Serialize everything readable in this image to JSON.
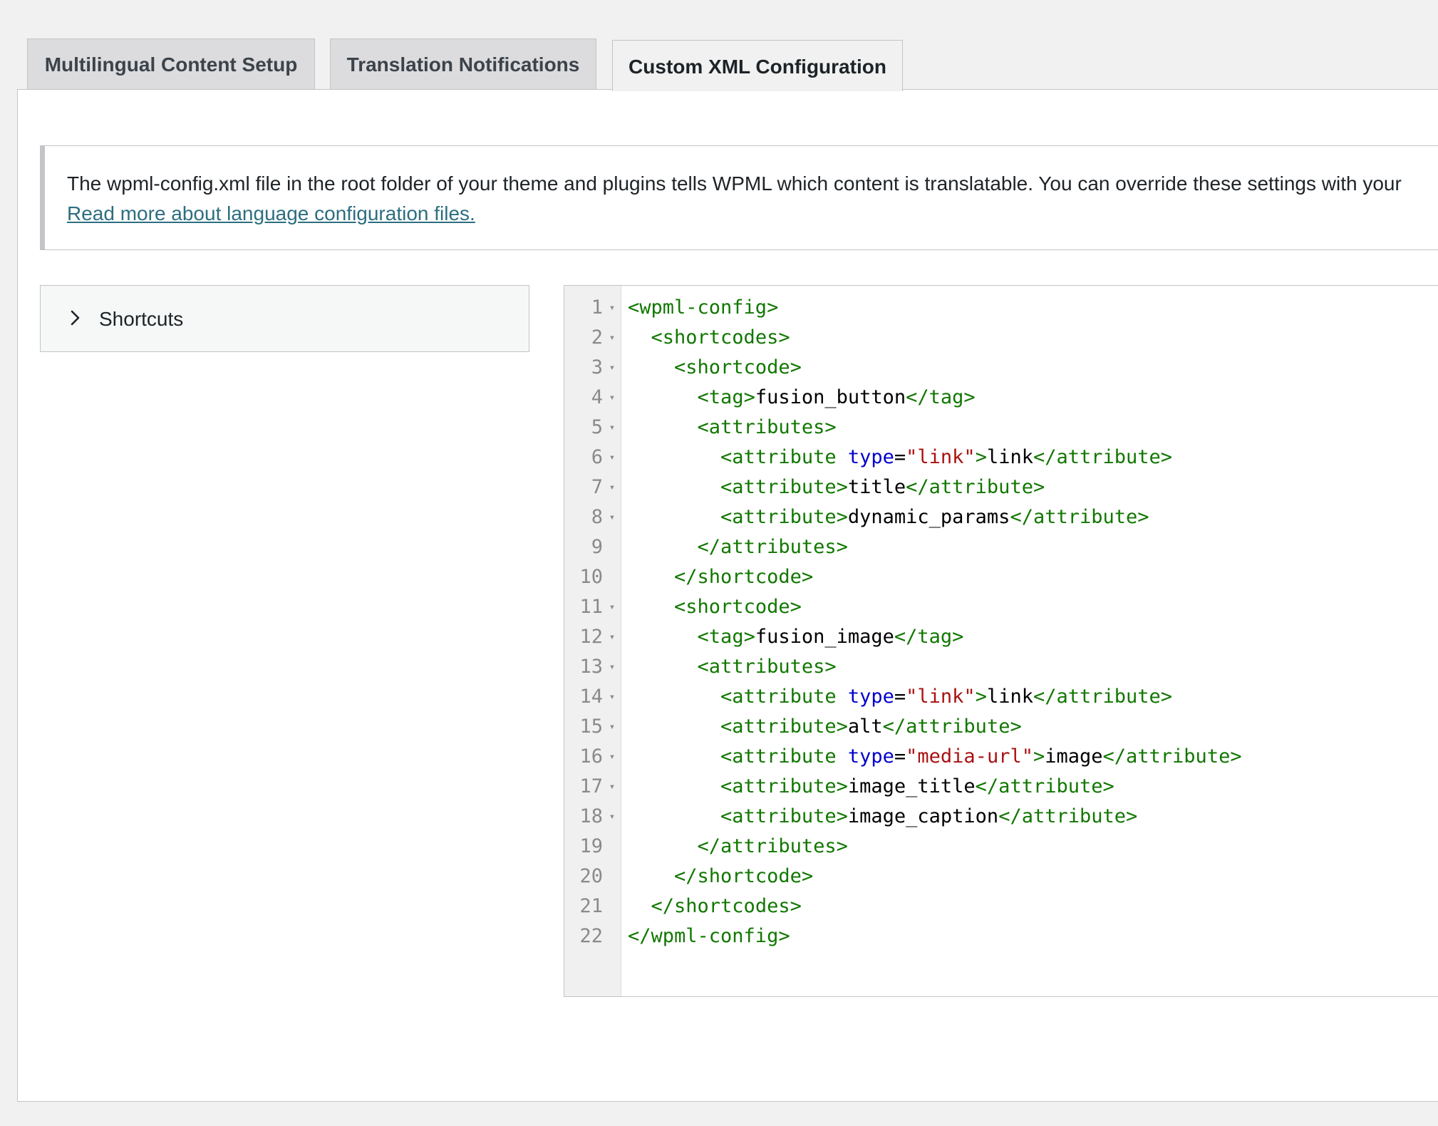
{
  "tabs": [
    {
      "label": "Multilingual Content Setup",
      "active": false
    },
    {
      "label": "Translation Notifications",
      "active": false
    },
    {
      "label": "Custom XML Configuration",
      "active": true
    }
  ],
  "notice": {
    "text": "The wpml-config.xml file in the root folder of your theme and plugins tells WPML which content is translatable. You can override these settings with your",
    "link_text": "Read more about language configuration files."
  },
  "shortcuts": {
    "label": "Shortcuts",
    "icon": "chevron-right-icon"
  },
  "editor": {
    "syntax_colors": {
      "tag": "#117700",
      "attribute": "#0000cc",
      "string": "#aa1111",
      "text": "#000000"
    },
    "lines": [
      {
        "n": "1",
        "fold": "▾",
        "tokens": [
          [
            "tg",
            "<wpml-config>"
          ]
        ]
      },
      {
        "n": "2",
        "fold": "▾",
        "tokens": [
          [
            "tx",
            "  "
          ],
          [
            "tg",
            "<shortcodes>"
          ]
        ]
      },
      {
        "n": "3",
        "fold": "▾",
        "tokens": [
          [
            "tx",
            "    "
          ],
          [
            "tg",
            "<shortcode>"
          ]
        ]
      },
      {
        "n": "4",
        "fold": "▾",
        "tokens": [
          [
            "tx",
            "      "
          ],
          [
            "tg",
            "<tag>"
          ],
          [
            "tx",
            "fusion_button"
          ],
          [
            "tg",
            "</tag>"
          ]
        ]
      },
      {
        "n": "5",
        "fold": "▾",
        "tokens": [
          [
            "tx",
            "      "
          ],
          [
            "tg",
            "<attributes>"
          ]
        ]
      },
      {
        "n": "6",
        "fold": "▾",
        "tokens": [
          [
            "tx",
            "        "
          ],
          [
            "tg",
            "<attribute "
          ],
          [
            "at",
            "type"
          ],
          [
            "tx",
            "="
          ],
          [
            "st",
            "\"link\""
          ],
          [
            "tg",
            ">"
          ],
          [
            "tx",
            "link"
          ],
          [
            "tg",
            "</attribute>"
          ]
        ]
      },
      {
        "n": "7",
        "fold": "▾",
        "tokens": [
          [
            "tx",
            "        "
          ],
          [
            "tg",
            "<attribute>"
          ],
          [
            "tx",
            "title"
          ],
          [
            "tg",
            "</attribute>"
          ]
        ]
      },
      {
        "n": "8",
        "fold": "▾",
        "tokens": [
          [
            "tx",
            "        "
          ],
          [
            "tg",
            "<attribute>"
          ],
          [
            "tx",
            "dynamic_params"
          ],
          [
            "tg",
            "</attribute>"
          ]
        ]
      },
      {
        "n": "9",
        "fold": "",
        "tokens": [
          [
            "tx",
            "      "
          ],
          [
            "tg",
            "</attributes>"
          ]
        ]
      },
      {
        "n": "10",
        "fold": "",
        "tokens": [
          [
            "tx",
            "    "
          ],
          [
            "tg",
            "</shortcode>"
          ]
        ]
      },
      {
        "n": "11",
        "fold": "▾",
        "tokens": [
          [
            "tx",
            "    "
          ],
          [
            "tg",
            "<shortcode>"
          ]
        ]
      },
      {
        "n": "12",
        "fold": "▾",
        "tokens": [
          [
            "tx",
            "      "
          ],
          [
            "tg",
            "<tag>"
          ],
          [
            "tx",
            "fusion_image"
          ],
          [
            "tg",
            "</tag>"
          ]
        ]
      },
      {
        "n": "13",
        "fold": "▾",
        "tokens": [
          [
            "tx",
            "      "
          ],
          [
            "tg",
            "<attributes>"
          ]
        ]
      },
      {
        "n": "14",
        "fold": "▾",
        "tokens": [
          [
            "tx",
            "        "
          ],
          [
            "tg",
            "<attribute "
          ],
          [
            "at",
            "type"
          ],
          [
            "tx",
            "="
          ],
          [
            "st",
            "\"link\""
          ],
          [
            "tg",
            ">"
          ],
          [
            "tx",
            "link"
          ],
          [
            "tg",
            "</attribute>"
          ]
        ]
      },
      {
        "n": "15",
        "fold": "▾",
        "tokens": [
          [
            "tx",
            "        "
          ],
          [
            "tg",
            "<attribute>"
          ],
          [
            "tx",
            "alt"
          ],
          [
            "tg",
            "</attribute>"
          ]
        ]
      },
      {
        "n": "16",
        "fold": "▾",
        "tokens": [
          [
            "tx",
            "        "
          ],
          [
            "tg",
            "<attribute "
          ],
          [
            "at",
            "type"
          ],
          [
            "tx",
            "="
          ],
          [
            "st",
            "\"media-url\""
          ],
          [
            "tg",
            ">"
          ],
          [
            "tx",
            "image"
          ],
          [
            "tg",
            "</attribute>"
          ]
        ]
      },
      {
        "n": "17",
        "fold": "▾",
        "tokens": [
          [
            "tx",
            "        "
          ],
          [
            "tg",
            "<attribute>"
          ],
          [
            "tx",
            "image_title"
          ],
          [
            "tg",
            "</attribute>"
          ]
        ]
      },
      {
        "n": "18",
        "fold": "▾",
        "tokens": [
          [
            "tx",
            "        "
          ],
          [
            "tg",
            "<attribute>"
          ],
          [
            "tx",
            "image_caption"
          ],
          [
            "tg",
            "</attribute>"
          ]
        ]
      },
      {
        "n": "19",
        "fold": "",
        "tokens": [
          [
            "tx",
            "      "
          ],
          [
            "tg",
            "</attributes>"
          ]
        ]
      },
      {
        "n": "20",
        "fold": "",
        "tokens": [
          [
            "tx",
            "    "
          ],
          [
            "tg",
            "</shortcode>"
          ]
        ]
      },
      {
        "n": "21",
        "fold": "",
        "tokens": [
          [
            "tx",
            "  "
          ],
          [
            "tg",
            "</shortcodes>"
          ]
        ]
      },
      {
        "n": "22",
        "fold": "",
        "tokens": [
          [
            "tg",
            "</wpml-config>"
          ]
        ]
      }
    ]
  }
}
